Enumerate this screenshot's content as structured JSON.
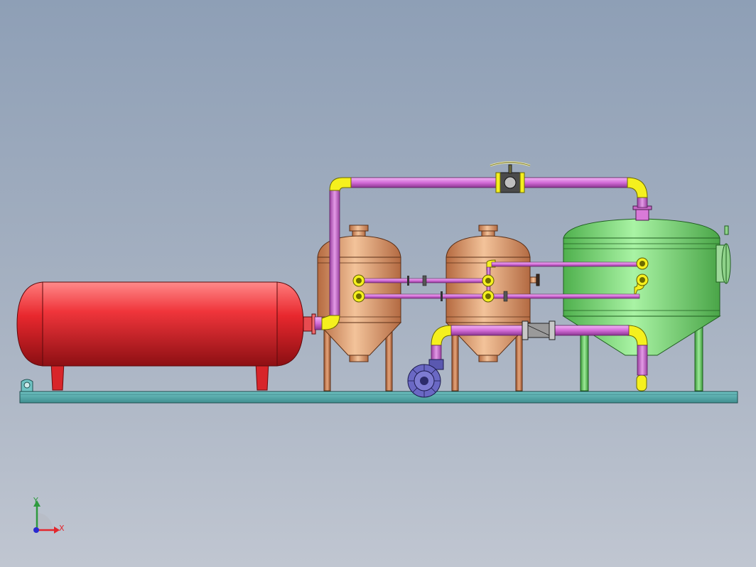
{
  "view": {
    "background_top": "#8e9fb6",
    "background_bottom": "#c0c6d1"
  },
  "assembly": {
    "horizontal_tank_color": "#e8353c",
    "vessel_a_color": "#e7a47a",
    "vessel_b_color": "#e7a47a",
    "vessel_c_color": "#86e082",
    "base_plate_color": "#4fa7a8",
    "pipe_color": "#d46fd8",
    "elbow_color": "#f5f01e",
    "pump_color": "#6a68c4",
    "valve_color": "#3a3a3a"
  },
  "triad": {
    "x_label": "X",
    "y_label": "Y",
    "x_color": "#e3262c",
    "y_color": "#2e9a3e",
    "z_color": "#2a2ad0"
  }
}
